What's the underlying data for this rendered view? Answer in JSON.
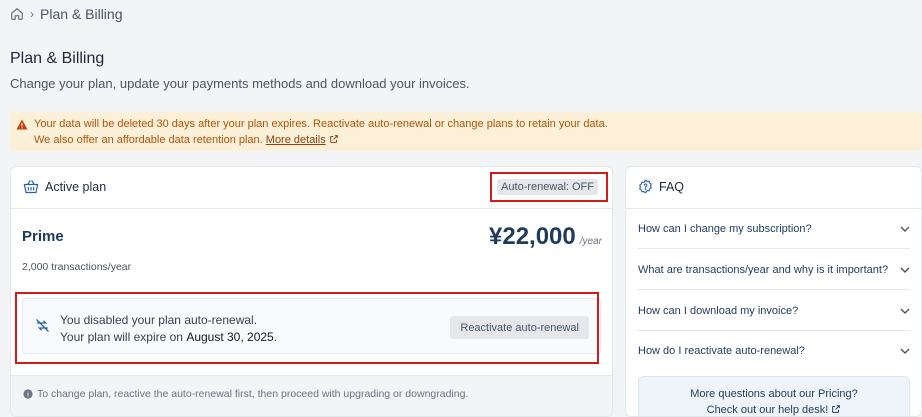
{
  "breadcrumb": {
    "home_icon": "home-icon",
    "current": "Plan & Billing"
  },
  "page": {
    "title": "Plan & Billing",
    "subtitle": "Change your plan, update your payments methods and download your invoices."
  },
  "alert": {
    "line1": "Your data will be deleted 30 days after your plan expires. Reactivate auto-renewal or change plans to retain your data.",
    "line2": "We also offer an affordable data retention plan.",
    "link": "More details"
  },
  "active_plan": {
    "title": "Active plan",
    "auto_renewal_badge": "Auto-renewal: OFF",
    "plan_name": "Prime",
    "price": "¥22,000",
    "period": "/year",
    "transactions": "2,000 transactions/year",
    "notice_line1": "You disabled your plan auto-renewal.",
    "notice_line2_prefix": "Your plan will expire on ",
    "notice_date": "August 30, 2025",
    "notice_line2_suffix": ".",
    "reactivate_label": "Reactivate auto-renewal",
    "footer_note": "To change plan, reactive the auto-renewal first, then proceed with upgrading or downgrading."
  },
  "faq": {
    "title": "FAQ",
    "items": [
      {
        "q": "How can I change my subscription?"
      },
      {
        "q": "What are transactions/year and why is it important?"
      },
      {
        "q": "How can I download my invoice?"
      },
      {
        "q": "How do I reactivate auto-renewal?"
      }
    ],
    "more_question": "More questions about our Pricing?",
    "more_link": "Check out our help desk!"
  },
  "colors": {
    "highlight": "#d11a1a",
    "accent": "#1f3b5c",
    "warning_bg": "#fdf0d8",
    "warning_text": "#b45309"
  }
}
